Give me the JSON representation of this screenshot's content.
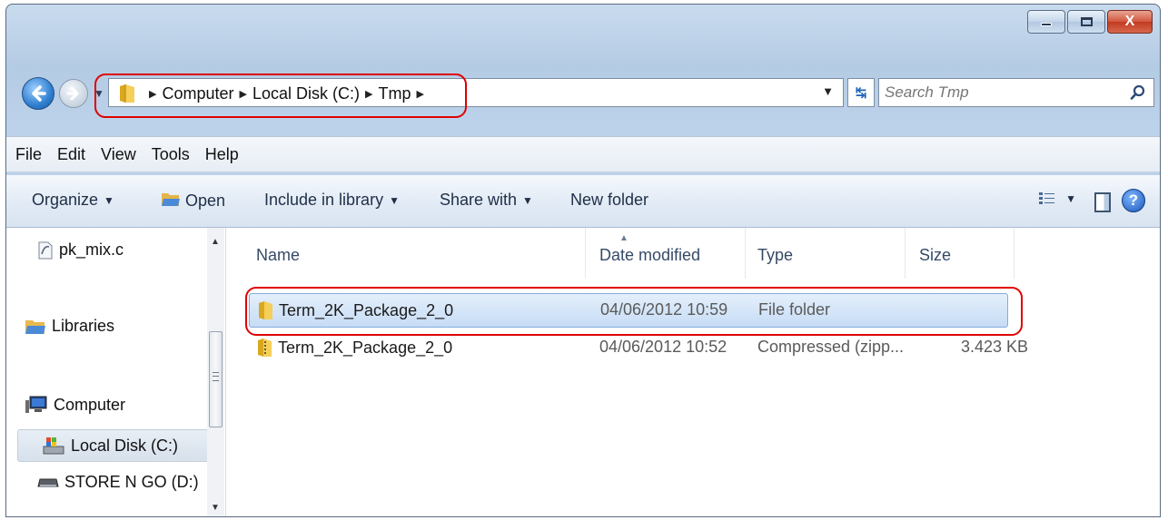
{
  "window": {
    "caption_buttons": [
      {
        "name": "minimize-button",
        "glyph": ""
      },
      {
        "name": "maximize-button",
        "glyph": ""
      },
      {
        "name": "close-button",
        "glyph": "X"
      }
    ]
  },
  "navigation": {
    "breadcrumbs": [
      "Computer",
      "Local Disk (C:)",
      "Tmp"
    ],
    "search_placeholder": "Search Tmp"
  },
  "menu": [
    "File",
    "Edit",
    "View",
    "Tools",
    "Help"
  ],
  "commands": {
    "organize": "Organize",
    "open": "Open",
    "include_in_library": "Include in library",
    "share_with": "Share with",
    "new_folder": "New folder"
  },
  "nav_pane": {
    "items": [
      {
        "label": "pk_mix.c",
        "icon": "c-file-icon"
      },
      {
        "label": "Libraries",
        "icon": "libraries-icon"
      },
      {
        "label": "Computer",
        "icon": "computer-icon"
      },
      {
        "label": "Local Disk (C:)",
        "icon": "local-disk-icon",
        "selected": true
      },
      {
        "label": "STORE N GO (D:)",
        "icon": "removable-drive-icon"
      }
    ]
  },
  "columns": [
    "Name",
    "Date modified",
    "Type",
    "Size"
  ],
  "files": [
    {
      "name": "Term_2K_Package_2_0",
      "date": "04/06/2012 10:59",
      "type": "File folder",
      "size": "",
      "icon": "folder-icon",
      "selected": true
    },
    {
      "name": "Term_2K_Package_2_0",
      "date": "04/06/2012 10:52",
      "type": "Compressed (zipp...",
      "size": "3.423 KB",
      "icon": "zip-folder-icon"
    }
  ],
  "colors": {
    "annotation": "#e00000",
    "selection": "#c6dcf5",
    "accent": "#1a56b8"
  }
}
